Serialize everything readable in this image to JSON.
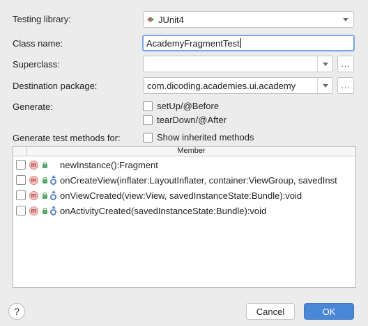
{
  "form": {
    "testing_library_label": "Testing library:",
    "testing_library_value": "JUnit4",
    "class_name_label": "Class name:",
    "class_name_value": "AcademyFragmentTest",
    "superclass_label": "Superclass:",
    "superclass_value": "",
    "destination_label": "Destination package:",
    "destination_value": "com.dicoding.academies.ui.academy",
    "browse_label": "...",
    "generate_label": "Generate:",
    "setup_label": "setUp/@Before",
    "teardown_label": "tearDown/@After",
    "generate_methods_label": "Generate test methods for:",
    "show_inherited_label": "Show inherited methods"
  },
  "table": {
    "column_header": "Member",
    "rows": [
      {
        "name": "newInstance():Fragment",
        "icon": "method-icon",
        "checked": false
      },
      {
        "name": "onCreateView(inflater:LayoutInflater, container:ViewGroup, savedInst",
        "icon": "method-icon",
        "checked": false
      },
      {
        "name": "onViewCreated(view:View, savedInstanceState:Bundle):void",
        "icon": "method-icon",
        "checked": false
      },
      {
        "name": "onActivityCreated(savedInstanceState:Bundle):void",
        "icon": "method-icon",
        "checked": false
      }
    ]
  },
  "footer": {
    "help_label": "?",
    "cancel_label": "Cancel",
    "ok_label": "OK"
  },
  "colors": {
    "accent": "#4a87d7",
    "focus_border": "#7aa7e6",
    "background": "#ececec"
  }
}
